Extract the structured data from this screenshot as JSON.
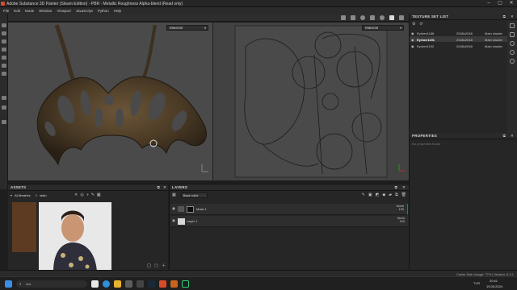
{
  "window": {
    "title": "Adobe Substance 3D Painter (Steam Edition) - PBR - Metallic Roughness Alpha-blend (Read only)",
    "controls": [
      "–",
      "▢",
      "✕"
    ]
  },
  "menu": [
    "File",
    "Edit",
    "Mode",
    "Window",
    "Viewport",
    "JavaScript",
    "Python",
    "Help"
  ],
  "viewport3d": {
    "material_select": "Material"
  },
  "viewport2d": {
    "material_select": "Material"
  },
  "texture_set_list": {
    "title": "TEXTURE SET LIST",
    "rows": [
      {
        "name": "Eyrbee1188",
        "size": "2048x2048",
        "shader": "Main shader"
      },
      {
        "name": "Eyrbee1191",
        "size": "2048x2048",
        "shader": "Main shader"
      },
      {
        "name": "Eyrbee1192",
        "size": "2048x2048",
        "shader": "Main shader"
      }
    ]
  },
  "properties": {
    "title": "PROPERTIES",
    "empty_text": "No properties found"
  },
  "assets": {
    "title": "ASSETS",
    "library": "All libraries",
    "search_value": "stain"
  },
  "layers": {
    "title": "LAYERS",
    "channel": "Base color",
    "items": [
      {
        "name": "Mask 1",
        "blend": "Norm",
        "opacity": "100"
      },
      {
        "name": "Layer 1",
        "blend": "Norm",
        "opacity": "100"
      }
    ]
  },
  "status": {
    "text": "Cache Disk Usage:   77%  |  Version: 8.3.1"
  },
  "taskbar": {
    "search_placeholder": "Ara",
    "language": "TUR",
    "time": "20:41",
    "date": "19.05.2024"
  },
  "colors": {
    "accent": "#2b7bd6",
    "panel": "#262626",
    "viewport3d": "#4a4a4a",
    "viewport2d": "#424242",
    "brand": "#d84b2a"
  }
}
